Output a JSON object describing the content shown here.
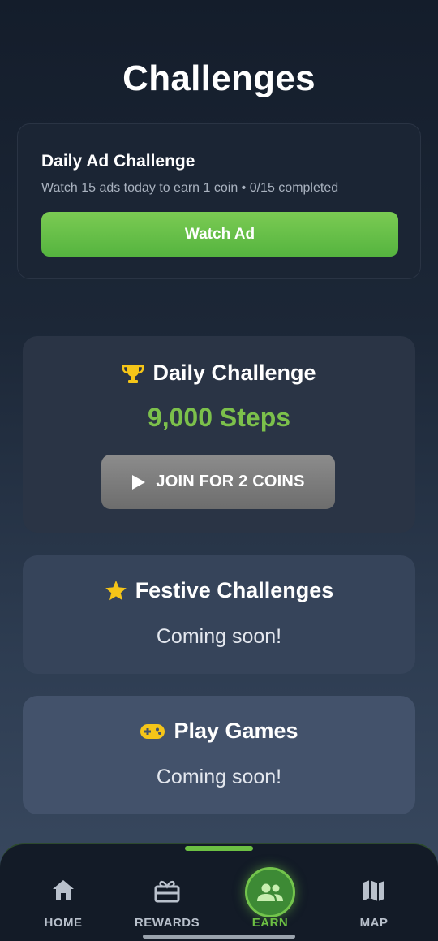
{
  "page": {
    "title": "Challenges"
  },
  "ad_challenge": {
    "title": "Daily Ad Challenge",
    "description": "Watch 15 ads today to earn 1 coin • 0/15 completed",
    "button_label": "Watch Ad",
    "progress": {
      "completed": 0,
      "total": 15
    }
  },
  "daily_challenge": {
    "icon": "trophy-icon",
    "title": "Daily Challenge",
    "goal": "9,000 Steps",
    "button_label": "JOIN FOR 2 COINS",
    "button_icon": "play-icon"
  },
  "festive_challenges": {
    "icon": "star-icon",
    "title": "Festive Challenges",
    "status": "Coming soon!"
  },
  "play_games": {
    "icon": "gamepad-icon",
    "title": "Play Games",
    "status": "Coming soon!"
  },
  "bottom_nav": {
    "items": [
      {
        "label": "HOME",
        "icon": "home-icon",
        "active": false
      },
      {
        "label": "REWARDS",
        "icon": "gift-icon",
        "active": false
      },
      {
        "label": "EARN",
        "icon": "group-icon",
        "active": true
      },
      {
        "label": "MAP",
        "icon": "map-icon",
        "active": false
      }
    ]
  },
  "colors": {
    "accent_green": "#6cc043",
    "steps_green": "#7cc04b",
    "gold": "#f5c518"
  }
}
